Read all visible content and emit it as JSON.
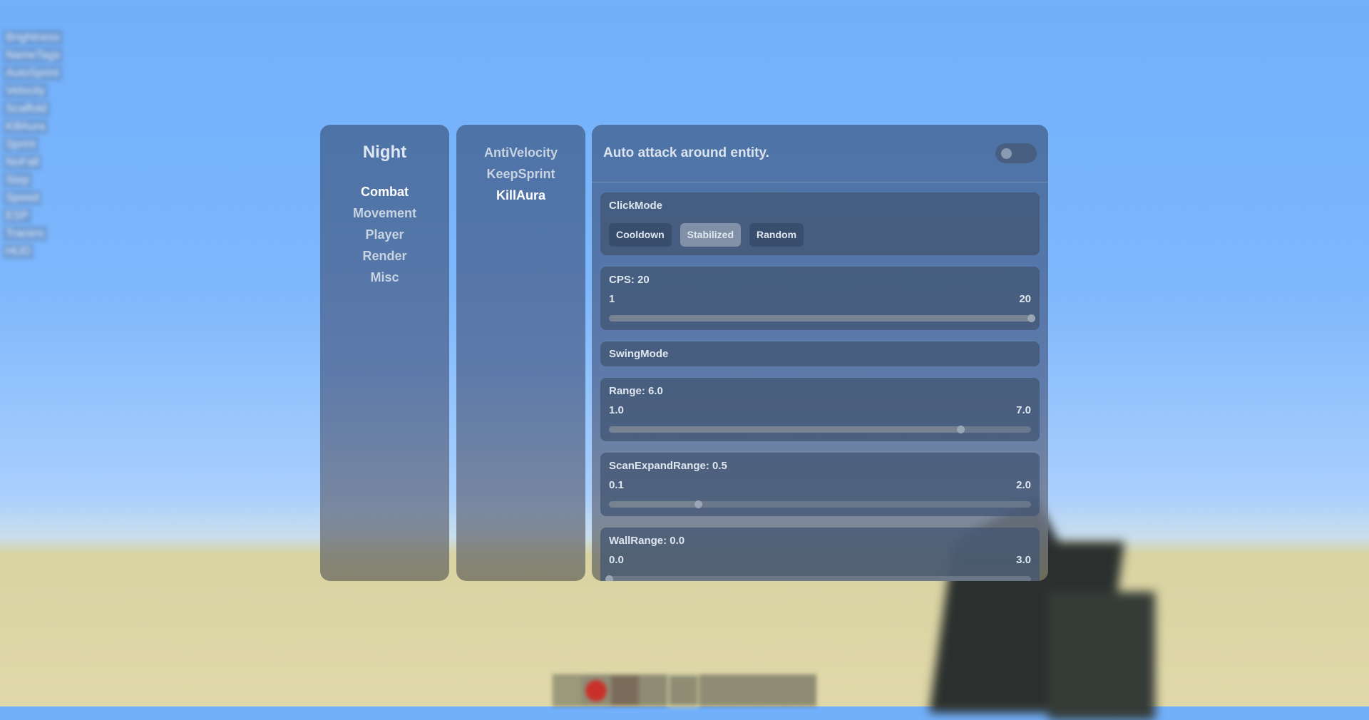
{
  "hud": {
    "modules": [
      "Brightness",
      "NameTags",
      "AutoSprint",
      "Velocity",
      "Scaffold",
      "KillAura",
      "Sprint",
      "NoFall",
      "Step",
      "Speed",
      "ESP",
      "Tracers",
      "HUD"
    ]
  },
  "clickgui": {
    "client_name": "Night",
    "categories": [
      {
        "label": "Combat",
        "active": true
      },
      {
        "label": "Movement",
        "active": false
      },
      {
        "label": "Player",
        "active": false
      },
      {
        "label": "Render",
        "active": false
      },
      {
        "label": "Misc",
        "active": false
      }
    ],
    "modules": [
      {
        "label": "AntiVelocity",
        "active": false
      },
      {
        "label": "KeepSprint",
        "active": false
      },
      {
        "label": "KillAura",
        "active": true
      }
    ],
    "module_description": "Auto attack around entity.",
    "module_enabled": false,
    "settings": {
      "click_mode": {
        "label": "ClickMode",
        "options": [
          "Cooldown",
          "Stabilized",
          "Random"
        ],
        "selected": "Stabilized"
      },
      "cps": {
        "label": "CPS: 20",
        "min": "1",
        "max": "20",
        "value": 20,
        "min_num": 1,
        "max_num": 20
      },
      "swing_mode": {
        "label": "SwingMode"
      },
      "range": {
        "label": "Range: 6.0",
        "min": "1.0",
        "max": "7.0",
        "value": 6.0,
        "min_num": 1.0,
        "max_num": 7.0
      },
      "scan_expand_range": {
        "label": "ScanExpandRange: 0.5",
        "min": "0.1",
        "max": "2.0",
        "value": 0.5,
        "min_num": 0.1,
        "max_num": 2.0
      },
      "wall_range": {
        "label": "WallRange: 0.0",
        "min": "0.0",
        "max": "3.0",
        "value": 0.0,
        "min_num": 0.0,
        "max_num": 3.0
      }
    }
  }
}
